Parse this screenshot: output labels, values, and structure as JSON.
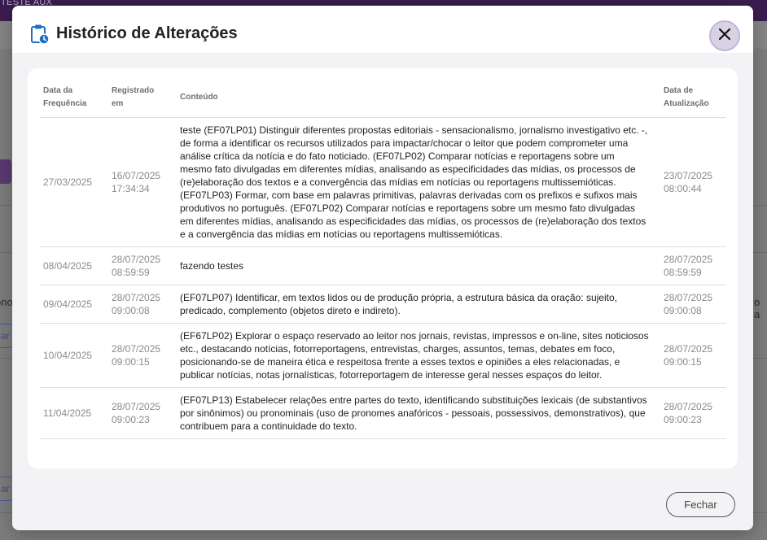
{
  "background": {
    "topbar_text": "DE TESTE AUX",
    "fragment_1": "ono",
    "fragment_2": "o a",
    "button_fragment_1": "ar",
    "button_fragment_2": "ar"
  },
  "modal": {
    "title": "Histórico de Alterações",
    "close_icon": "close-icon",
    "title_icon": "clipboard-clock-icon",
    "footer_button": "Fechar"
  },
  "table": {
    "headers": {
      "freq_date": [
        "Data da",
        "Frequência"
      ],
      "registered": [
        "Registrado",
        "em"
      ],
      "content": "Conteúdo",
      "updated": [
        "Data de",
        "Atualização"
      ]
    },
    "rows": [
      {
        "freq_date": "27/03/2025",
        "registered_date": "16/07/2025",
        "registered_time": "17:34:34",
        "content": "teste (EF07LP01) Distinguir diferentes propostas editoriais - sensacionalismo, jornalismo investigativo etc. -, de forma a identificar os recursos utilizados para impactar/chocar o leitor que podem comprometer uma análise crítica da notícia e do fato noticiado. (EF07LP02) Comparar notícias e reportagens sobre um mesmo fato divulgadas em diferentes mídias, analisando as especificidades das mídias, os processos de (re)elaboração dos textos e a convergência das mídias em notícias ou reportagens multissemióticas. (EF07LP03) Formar, com base em palavras primitivas, palavras derivadas com os prefixos e sufixos mais produtivos no português. (EF07LP02) Comparar notícias e reportagens sobre um mesmo fato divulgadas em diferentes mídias, analisando as especificidades das mídias, os processos de (re)elaboração dos textos e a convergência das mídias em notícias ou reportagens multissemióticas.",
        "updated_date": "23/07/2025",
        "updated_time": "08:00:44"
      },
      {
        "freq_date": "08/04/2025",
        "registered_date": "28/07/2025",
        "registered_time": "08:59:59",
        "content": "fazendo testes",
        "updated_date": "28/07/2025",
        "updated_time": "08:59:59"
      },
      {
        "freq_date": "09/04/2025",
        "registered_date": "28/07/2025",
        "registered_time": "09:00:08",
        "content": "(EF07LP07) Identificar, em textos lidos ou de produção própria, a estrutura básica da oração: sujeito, predicado, complemento (objetos direto e indireto).",
        "updated_date": "28/07/2025",
        "updated_time": "09:00:08"
      },
      {
        "freq_date": "10/04/2025",
        "registered_date": "28/07/2025",
        "registered_time": "09:00:15",
        "content": "(EF67LP02) Explorar o espaço reservado ao leitor nos jornais, revistas, impressos e on-line, sites noticiosos etc., destacando notícias, fotorreportagens, entrevistas, charges, assuntos, temas, debates em foco, posicionando-se de maneira ética e respeitosa frente a esses textos e opiniões a eles relacionadas, e publicar notícias, notas jornalísticas, fotorreportagem de interesse geral nesses espaços do leitor.",
        "updated_date": "28/07/2025",
        "updated_time": "09:00:15"
      },
      {
        "freq_date": "11/04/2025",
        "registered_date": "28/07/2025",
        "registered_time": "09:00:23",
        "content": "(EF07LP13) Estabelecer relações entre partes do texto, identificando substituições lexicais (de substantivos por sinônimos) ou pronominais (uso de pronomes anafóricos - pessoais, possessivos, demonstrativos), que contribuem para a continuidade do texto.",
        "updated_date": "28/07/2025",
        "updated_time": "09:00:23"
      }
    ]
  }
}
